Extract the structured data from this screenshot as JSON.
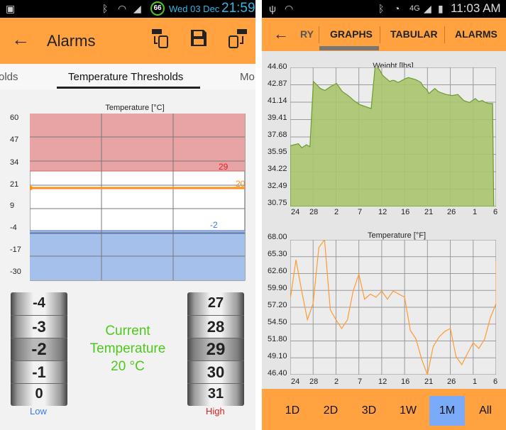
{
  "left_screen": {
    "status_bar": {
      "battery_level": "66",
      "date": "Wed 03 Dec",
      "time": "21:59"
    },
    "action_bar": {
      "title": "Alarms",
      "back_icon": "arrow-left-icon",
      "icons": [
        "phone-transfer-icon",
        "save-icon",
        "phone-sync-icon"
      ]
    },
    "tabs": [
      {
        "label": "olds",
        "active": false
      },
      {
        "label": "Temperature Thresholds",
        "active": true
      },
      {
        "label": "Mo",
        "active": false
      }
    ],
    "chart": {
      "title": "Temperature [°C]",
      "y_ticks": [
        "60",
        "47",
        "34",
        "21",
        "9",
        "-4",
        "-17",
        "-30"
      ],
      "high_threshold_label": "29",
      "current_label": "20",
      "low_threshold_label": "-2"
    },
    "low_drum": {
      "values": [
        "-4",
        "-3",
        "-2",
        "-1",
        "0"
      ],
      "caption": "Low"
    },
    "high_drum": {
      "values": [
        "27",
        "28",
        "29",
        "30",
        "31"
      ],
      "caption": "High"
    },
    "current_temperature": {
      "line1": "Current",
      "line2": "Temperature",
      "line3": "20 °C"
    },
    "colors": {
      "accent": "#ffa23f",
      "high_zone": "#e8a4a4",
      "low_zone": "#a6c0ec",
      "current_line": "#ff8c1a",
      "current_text": "#4fc81e",
      "low_caption": "#3a7de0",
      "high_caption": "#e02020"
    }
  },
  "right_screen": {
    "status_bar": {
      "time": "11:03 AM"
    },
    "action_bar": {
      "back_icon": "arrow-left-icon",
      "tabs": [
        {
          "label": "RY",
          "active": false
        },
        {
          "label": "GRAPHS",
          "active": true
        },
        {
          "label": "TABULAR",
          "active": false
        },
        {
          "label": "ALARMS",
          "active": false
        }
      ]
    },
    "range_buttons": [
      {
        "label": "1D",
        "active": false
      },
      {
        "label": "2D",
        "active": false
      },
      {
        "label": "3D",
        "active": false
      },
      {
        "label": "1W",
        "active": false
      },
      {
        "label": "1M",
        "active": true
      },
      {
        "label": "All",
        "active": false
      }
    ],
    "weight_chart": {
      "title": "Weight [lbs]",
      "y_ticks": [
        "44.60",
        "42.87",
        "41.14",
        "39.41",
        "37.68",
        "35.95",
        "34.22",
        "32.49",
        "30.75"
      ],
      "x_ticks": [
        "24",
        "28",
        "2",
        "7",
        "12",
        "16",
        "21",
        "26",
        "1",
        "6"
      ]
    },
    "temperature_chart": {
      "title": "Temperature [°F]",
      "y_ticks": [
        "68.00",
        "65.30",
        "62.60",
        "59.90",
        "57.20",
        "54.50",
        "51.80",
        "49.10",
        "46.40"
      ],
      "x_ticks": [
        "24",
        "28",
        "2",
        "7",
        "12",
        "16",
        "21",
        "26",
        "1",
        "6"
      ]
    }
  },
  "chart_data": [
    {
      "type": "area",
      "title": "Weight [lbs]",
      "ylim": [
        30.75,
        44.6
      ],
      "x_tick_labels": [
        "24",
        "28",
        "2",
        "7",
        "12",
        "16",
        "21",
        "26",
        "1",
        "6"
      ],
      "x_index": [
        0,
        0.35,
        0.7,
        1.0,
        1.4,
        1.7,
        2.0,
        2.35,
        2.6,
        3.0,
        3.5,
        4.0,
        4.5,
        5.0,
        5.5,
        6.0,
        6.5,
        7.0,
        7.35,
        7.7,
        8.0,
        8.3,
        8.6,
        8.8,
        9.0,
        9.15,
        9.3,
        9.5,
        9.8,
        10.0,
        10.2,
        10.5,
        10.8,
        11.0,
        11.3,
        11.5,
        11.8,
        12.0,
        12.3,
        12.5,
        12.8,
        13.0,
        13.5,
        14.0,
        14.5,
        15.0,
        15.5,
        16.0,
        16.3,
        16.6,
        16.9,
        17.2,
        17.5,
        17.6,
        17.8
      ],
      "values": [
        36.8,
        36.9,
        37.0,
        36.6,
        36.9,
        36.7,
        43.2,
        42.8,
        42.5,
        42.3,
        42.7,
        43.0,
        42.2,
        41.8,
        41.3,
        40.9,
        40.7,
        40.5,
        44.8,
        44.4,
        43.8,
        43.5,
        43.2,
        43.3,
        43.3,
        43.2,
        43.1,
        43.2,
        43.4,
        43.5,
        43.6,
        43.5,
        43.4,
        43.3,
        43.1,
        42.7,
        42.4,
        42.0,
        42.3,
        42.5,
        42.2,
        42.1,
        41.9,
        41.8,
        41.9,
        41.3,
        41.1,
        41.5,
        41.2,
        41.3,
        41.1,
        41.0,
        41.0,
        30.75,
        30.75
      ],
      "fill_color": "#a8c46e",
      "grid": true
    },
    {
      "type": "line",
      "title": "Temperature [°F]",
      "ylim": [
        46.4,
        68.0
      ],
      "x_tick_labels": [
        "24",
        "28",
        "2",
        "7",
        "12",
        "16",
        "21",
        "26",
        "1",
        "6"
      ],
      "x_index": [
        0,
        0.5,
        1.0,
        1.5,
        2.0,
        2.5,
        3.0,
        3.5,
        4.0,
        4.5,
        5.0,
        5.5,
        6.0,
        6.5,
        7.0,
        7.5,
        8.0,
        8.5,
        9.0,
        9.5,
        10.0,
        10.5,
        11.0,
        11.5,
        12.0,
        12.5,
        13.0,
        13.5,
        14.0,
        14.5,
        15.0,
        15.5,
        16.0,
        16.5,
        17.0,
        17.5,
        18.0
      ],
      "values": [
        58.5,
        64.8,
        59.8,
        55.2,
        57.8,
        66.8,
        68.0,
        56.8,
        55.2,
        53.8,
        55.2,
        59.8,
        62.5,
        58.5,
        59.3,
        58.8,
        59.8,
        58.5,
        59.8,
        59.3,
        58.8,
        53.5,
        52.1,
        48.8,
        46.4,
        50.9,
        52.4,
        53.3,
        53.8,
        49.3,
        48.0,
        49.8,
        51.5,
        50.6,
        52.1,
        55.5,
        57.8,
        59.3,
        64.5
      ],
      "color": "#ff9a33",
      "grid": true
    },
    {
      "type": "area",
      "title": "Temperature [°C]",
      "ylim": [
        -30,
        60
      ],
      "y_tick_labels": [
        "60",
        "47",
        "34",
        "21",
        "9",
        "-4",
        "-17",
        "-30"
      ],
      "high_threshold": 29,
      "low_threshold": -2,
      "current": 20
    }
  ]
}
